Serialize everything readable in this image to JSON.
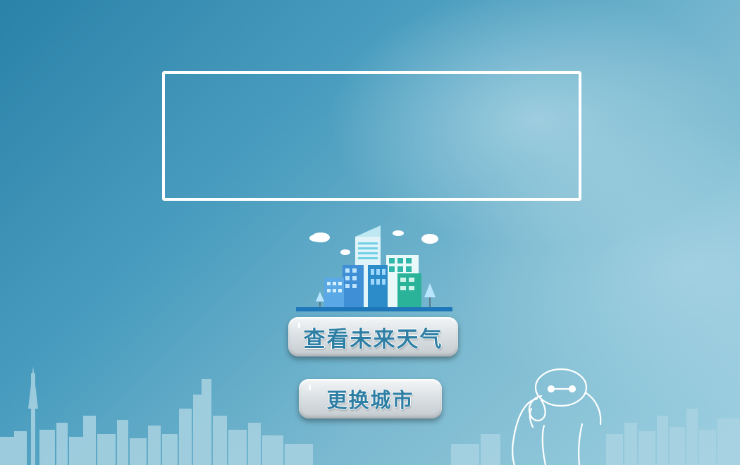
{
  "app": {
    "weather_panel": {},
    "buttons": {
      "forecast_label": "查看未来天气",
      "change_city_label": "更换城市"
    }
  },
  "icons": {
    "city_illustration": "city-buildings-icon",
    "mascot": "baymax-mascot-icon",
    "skyline": "city-skyline-icon"
  },
  "colors": {
    "background_start": "#2a82a9",
    "background_end": "#9dcfe0",
    "panel_border": "#ffffff",
    "button_text": "#2f7fa5"
  }
}
